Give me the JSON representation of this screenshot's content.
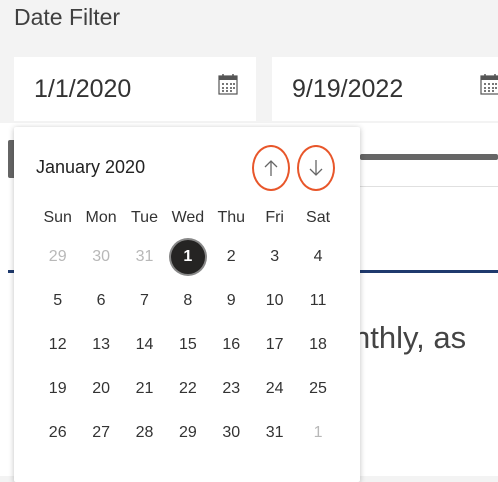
{
  "filter": {
    "title": "Date Filter",
    "start_date": "1/1/2020",
    "end_date": "9/19/2022",
    "calendar_icon": "calendar-icon"
  },
  "background": {
    "partial_text": "nthly, as"
  },
  "calendar": {
    "month_label": "January 2020",
    "prev_icon": "arrow-up-icon",
    "next_icon": "arrow-down-icon",
    "highlight_color": "#e8562a",
    "selected_day": "1",
    "weekdays": [
      "Sun",
      "Mon",
      "Tue",
      "Wed",
      "Thu",
      "Fri",
      "Sat"
    ],
    "weeks": [
      [
        {
          "d": "29",
          "muted": true
        },
        {
          "d": "30",
          "muted": true
        },
        {
          "d": "31",
          "muted": true
        },
        {
          "d": "1",
          "sel": true
        },
        {
          "d": "2"
        },
        {
          "d": "3"
        },
        {
          "d": "4"
        }
      ],
      [
        {
          "d": "5"
        },
        {
          "d": "6"
        },
        {
          "d": "7"
        },
        {
          "d": "8"
        },
        {
          "d": "9"
        },
        {
          "d": "10"
        },
        {
          "d": "11"
        }
      ],
      [
        {
          "d": "12"
        },
        {
          "d": "13"
        },
        {
          "d": "14"
        },
        {
          "d": "15"
        },
        {
          "d": "16"
        },
        {
          "d": "17"
        },
        {
          "d": "18"
        }
      ],
      [
        {
          "d": "19"
        },
        {
          "d": "20"
        },
        {
          "d": "21"
        },
        {
          "d": "22"
        },
        {
          "d": "23"
        },
        {
          "d": "24"
        },
        {
          "d": "25"
        }
      ],
      [
        {
          "d": "26"
        },
        {
          "d": "27"
        },
        {
          "d": "28"
        },
        {
          "d": "29"
        },
        {
          "d": "30"
        },
        {
          "d": "31"
        },
        {
          "d": "1",
          "muted": true
        }
      ]
    ]
  }
}
